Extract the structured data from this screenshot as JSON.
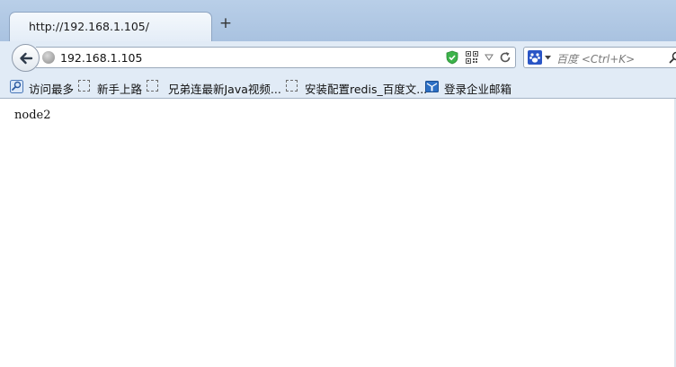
{
  "tab": {
    "title": "http://192.168.1.105/"
  },
  "new_tab_label": "+",
  "urlbar": {
    "value": "192.168.1.105"
  },
  "search": {
    "placeholder": "百度 <Ctrl+K>"
  },
  "bookmarks": [
    {
      "label": "访问最多",
      "icon": "magnifier-bookmark-icon"
    },
    {
      "label": "新手上路",
      "icon": "placeholder-favicon"
    },
    {
      "label": "兄弟连最新Java视频...",
      "icon": "placeholder-favicon"
    },
    {
      "label": "安装配置redis_百度文...",
      "icon": "placeholder-favicon"
    },
    {
      "label": "登录企业邮箱",
      "icon": "mail-book-icon"
    }
  ],
  "page": {
    "text": "node2"
  },
  "colors": {
    "tabstrip": "#b9cfe8",
    "toolbar": "#e1ebf6",
    "shield": "#3cb34a",
    "search_engine": "#2a55c6"
  }
}
